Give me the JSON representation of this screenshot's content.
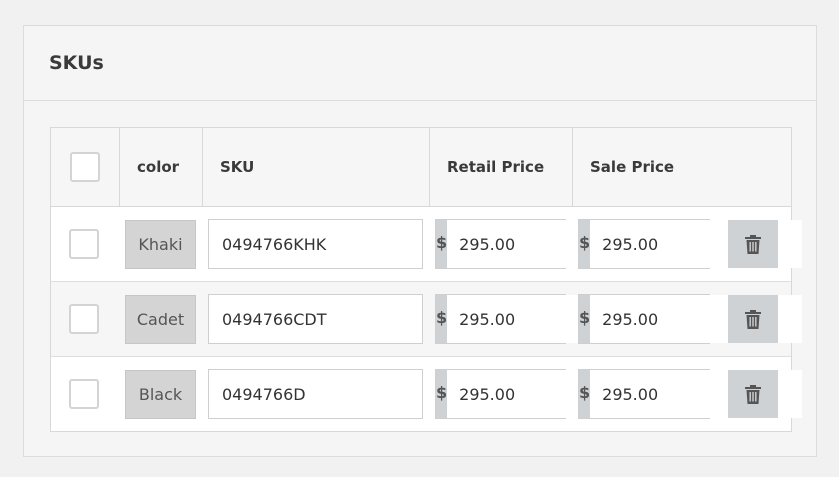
{
  "panel": {
    "title": "SKUs"
  },
  "table": {
    "headers": {
      "color": "color",
      "sku": "SKU",
      "retail": "Retail Price",
      "sale": "Sale Price"
    },
    "currency_symbol": "$",
    "rows": [
      {
        "color": "Khaki",
        "sku": "0494766KHK",
        "retail": "295.00",
        "sale": "295.00"
      },
      {
        "color": "Cadet",
        "sku": "0494766CDT",
        "retail": "295.00",
        "sale": "295.00"
      },
      {
        "color": "Black",
        "sku": "0494766D",
        "retail": "295.00",
        "sale": "295.00"
      }
    ]
  },
  "icons": {
    "delete": "trash-icon"
  },
  "colors": {
    "chip_bg": "#d4d4d4",
    "addon_bg": "#cfd2d5",
    "border": "#d8d8d8"
  }
}
